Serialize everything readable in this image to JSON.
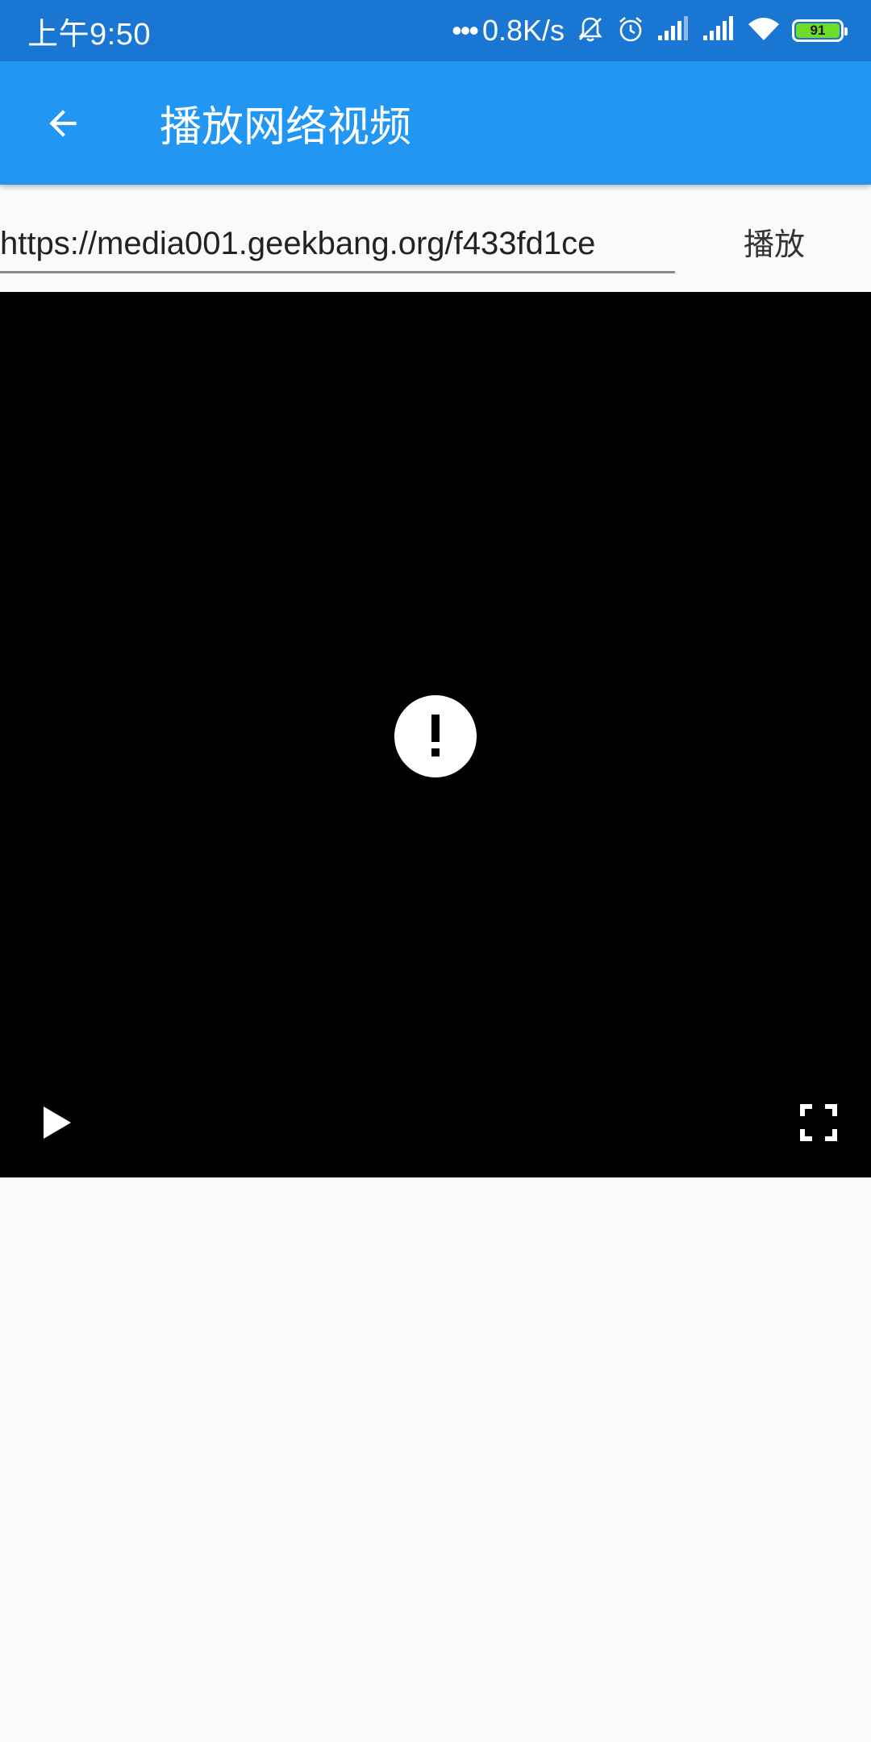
{
  "status_bar": {
    "time": "上午9:50",
    "dots": "•••",
    "network_speed": "0.8K/s",
    "battery_level": "91",
    "icons": [
      "mute-icon",
      "alarm-icon",
      "signal-icon",
      "signal-icon",
      "wifi-icon",
      "battery-icon"
    ]
  },
  "app_bar": {
    "back_icon": "arrow-back-icon",
    "title": "播放网络视频",
    "color": "#2196f3"
  },
  "url_row": {
    "input_value": "https://media001.geekbang.org/f433fd1ce",
    "play_button_label": "播放"
  },
  "video_player": {
    "state_icon": "error-icon",
    "controls": [
      "play-icon",
      "fullscreen-icon"
    ],
    "background": "#000000"
  }
}
